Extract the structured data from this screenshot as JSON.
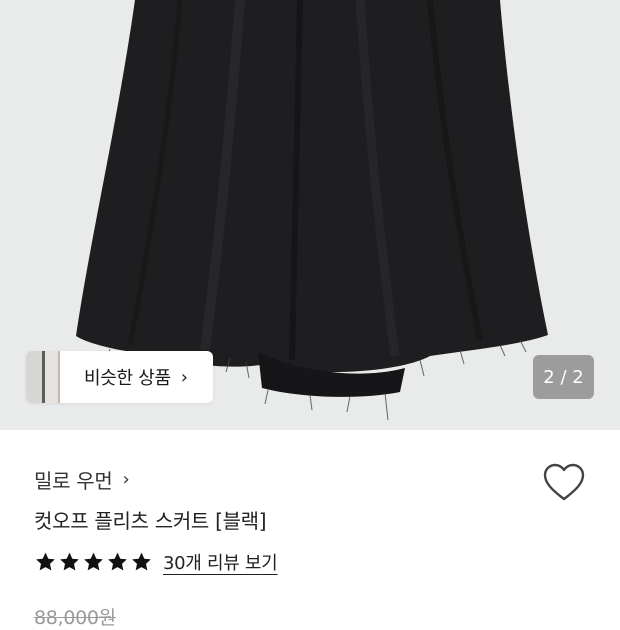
{
  "gallery": {
    "image_alt": "",
    "pager_text": "2 / 2",
    "similar_label": "비슷한 상품",
    "chevron": "›"
  },
  "product": {
    "brand": "밀로 우먼",
    "brand_chevron": "›",
    "name": "컷오프 플리츠 스커트 [블랙]",
    "rating": 5,
    "review_link": "30개 리뷰 보기",
    "original_price": "88,000원"
  },
  "colors": {
    "background": "#ffffff",
    "hero_bg": "#e9eaea",
    "skirt": "#1e1e20",
    "pager_bg": "#9c9c9c",
    "strikethrough_price": "#9a9a9a"
  },
  "icons": {
    "wishlist": "heart-outline-icon",
    "star": "star-filled-icon",
    "chevron": "chevron-right-icon"
  }
}
